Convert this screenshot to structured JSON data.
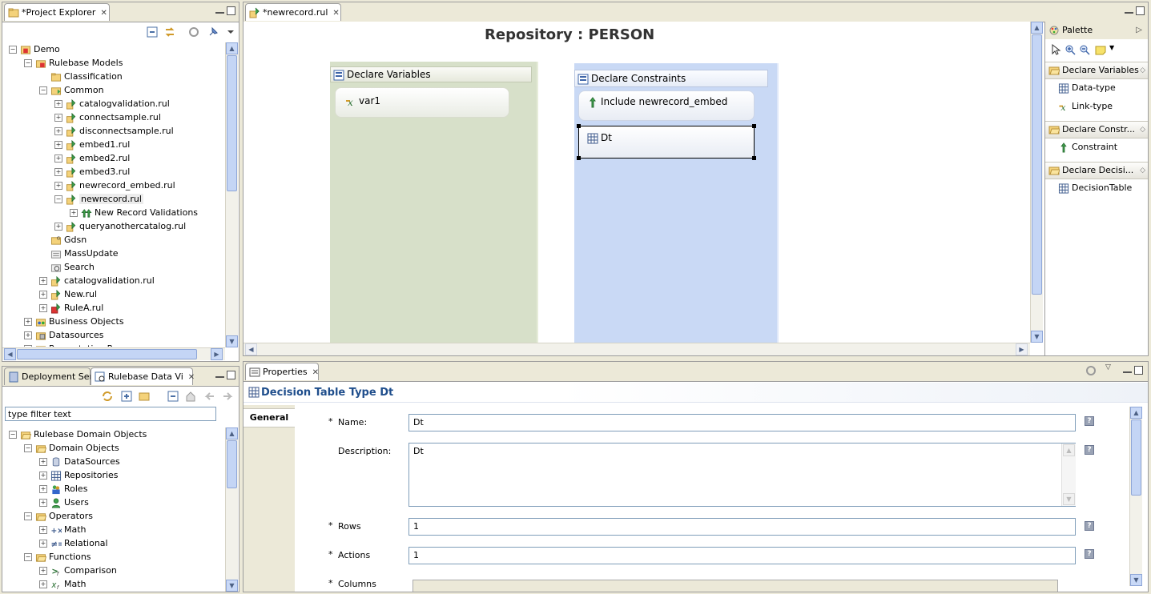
{
  "project_explorer": {
    "tab_label": "*Project Explorer",
    "tree": [
      {
        "label": "Demo",
        "indent": 0,
        "exp": "-",
        "icon": "project"
      },
      {
        "label": "Rulebase Models",
        "indent": 1,
        "exp": "-",
        "icon": "folder-rule"
      },
      {
        "label": "Classification",
        "indent": 2,
        "exp": "",
        "icon": "folder"
      },
      {
        "label": "Common",
        "indent": 2,
        "exp": "-",
        "icon": "folder-common"
      },
      {
        "label": "catalogvalidation.rul",
        "indent": 3,
        "exp": "+",
        "icon": "rul"
      },
      {
        "label": "connectsample.rul",
        "indent": 3,
        "exp": "+",
        "icon": "rul"
      },
      {
        "label": "disconnectsample.rul",
        "indent": 3,
        "exp": "+",
        "icon": "rul"
      },
      {
        "label": "embed1.rul",
        "indent": 3,
        "exp": "+",
        "icon": "rul"
      },
      {
        "label": "embed2.rul",
        "indent": 3,
        "exp": "+",
        "icon": "rul"
      },
      {
        "label": "embed3.rul",
        "indent": 3,
        "exp": "+",
        "icon": "rul"
      },
      {
        "label": "newrecord_embed.rul",
        "indent": 3,
        "exp": "+",
        "icon": "rul"
      },
      {
        "label": "newrecord.rul",
        "indent": 3,
        "exp": "-",
        "icon": "rul",
        "selected": true
      },
      {
        "label": "New Record Validations",
        "indent": 4,
        "exp": "+",
        "icon": "rule"
      },
      {
        "label": "queryanothercatalog.rul",
        "indent": 3,
        "exp": "+",
        "icon": "rul"
      },
      {
        "label": "Gdsn",
        "indent": 2,
        "exp": "",
        "icon": "gdsn"
      },
      {
        "label": "MassUpdate",
        "indent": 2,
        "exp": "",
        "icon": "mass"
      },
      {
        "label": "Search",
        "indent": 2,
        "exp": "",
        "icon": "search"
      },
      {
        "label": "catalogvalidation.rul",
        "indent": 2,
        "exp": "+",
        "icon": "rul"
      },
      {
        "label": "New.rul",
        "indent": 2,
        "exp": "+",
        "icon": "rul"
      },
      {
        "label": "RuleA.rul",
        "indent": 2,
        "exp": "+",
        "icon": "rul-red"
      },
      {
        "label": "Business Objects",
        "indent": 1,
        "exp": "+",
        "icon": "bo"
      },
      {
        "label": "Datasources",
        "indent": 1,
        "exp": "+",
        "icon": "ds"
      },
      {
        "label": "Presentation Resources",
        "indent": 1,
        "exp": "+",
        "icon": "pr"
      }
    ]
  },
  "domain_view": {
    "tab1": "Deployment Serv",
    "tab2": "Rulebase Data Vi",
    "filter_value": "type filter text",
    "tree": [
      {
        "label": "Rulebase Domain Objects",
        "indent": 0,
        "exp": "-",
        "icon": "folder-open"
      },
      {
        "label": "Domain Objects",
        "indent": 1,
        "exp": "-",
        "icon": "folder-open"
      },
      {
        "label": "DataSources",
        "indent": 2,
        "exp": "+",
        "icon": "db"
      },
      {
        "label": "Repositories",
        "indent": 2,
        "exp": "+",
        "icon": "grid"
      },
      {
        "label": "Roles",
        "indent": 2,
        "exp": "+",
        "icon": "roles"
      },
      {
        "label": "Users",
        "indent": 2,
        "exp": "+",
        "icon": "user"
      },
      {
        "label": "Operators",
        "indent": 1,
        "exp": "-",
        "icon": "folder-open"
      },
      {
        "label": "Math",
        "indent": 2,
        "exp": "+",
        "icon": "math"
      },
      {
        "label": "Relational",
        "indent": 2,
        "exp": "+",
        "icon": "rel"
      },
      {
        "label": "Functions",
        "indent": 1,
        "exp": "-",
        "icon": "folder-open"
      },
      {
        "label": "Comparison",
        "indent": 2,
        "exp": "+",
        "icon": "fcomp"
      },
      {
        "label": "Math",
        "indent": 2,
        "exp": "+",
        "icon": "fmath"
      }
    ]
  },
  "editor": {
    "tab_label": "*newrecord.rul",
    "title": "Repository : PERSON",
    "declare_variables": {
      "header": "Declare Variables",
      "items": [
        "var1"
      ]
    },
    "declare_constraints": {
      "header": "Declare Constraints",
      "items": [
        "Include newrecord_embed",
        "Dt"
      ]
    }
  },
  "palette": {
    "title": "Palette",
    "groups": [
      {
        "label": "Declare Variables",
        "items": [
          {
            "label": "Data-type",
            "icon": "grid"
          },
          {
            "label": "Link-type",
            "icon": "link"
          }
        ]
      },
      {
        "label": "Declare Constr...",
        "items": [
          {
            "label": "Constraint",
            "icon": "constraint"
          }
        ]
      },
      {
        "label": "Declare Decisi...",
        "items": [
          {
            "label": "DecisionTable",
            "icon": "grid"
          }
        ]
      }
    ]
  },
  "properties": {
    "tab_label": "Properties",
    "header": "Decision Table Type Dt",
    "section_tab": "General",
    "fields": {
      "name_label": "Name:",
      "name_value": "Dt",
      "description_label": "Description:",
      "description_value": "Dt",
      "rows_label": "Rows",
      "rows_value": "1",
      "actions_label": "Actions",
      "actions_value": "1",
      "columns_label": "Columns"
    },
    "required_mark": "*",
    "help_glyph": "?"
  },
  "colors": {
    "accent_title": "#1f4e8c",
    "var_column": "#d7e0c9",
    "constraint_column": "#c9d9f5",
    "tab_bg": "#ece9d8"
  }
}
